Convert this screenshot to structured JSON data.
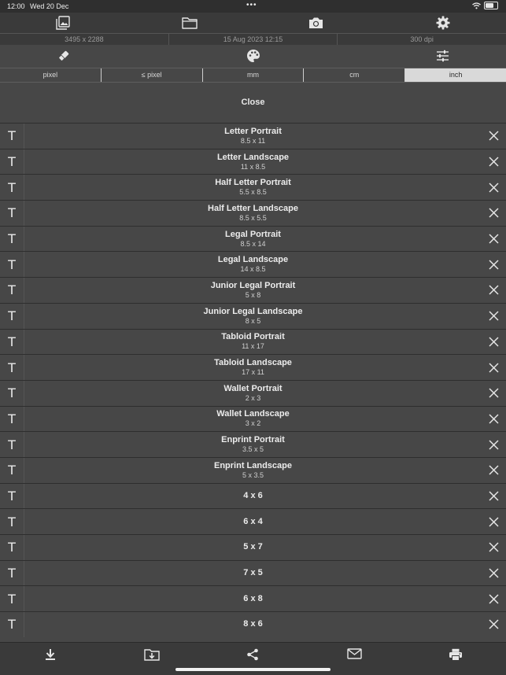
{
  "status_bar": {
    "time": "12:00",
    "date": "Wed 20 Dec",
    "dots": "•••"
  },
  "toolbar_top": {
    "icons": [
      "photo-library-icon",
      "folder-icon",
      "camera-icon",
      "gear-icon"
    ]
  },
  "info": {
    "dimensions": "3495 x 2288",
    "datetime": "15 Aug 2023 12:15",
    "dpi": "300 dpi"
  },
  "toolbar_second": {
    "icons": [
      "eraser-icon",
      "palette-icon",
      "sliders-icon"
    ]
  },
  "unit_tabs": {
    "items": [
      "pixel",
      "≤ pixel",
      "mm",
      "cm",
      "inch"
    ],
    "selected": "inch"
  },
  "close_label": "Close",
  "row_glyph": "T",
  "presets": [
    {
      "name": "Letter Portrait",
      "size": "8.5 x 11"
    },
    {
      "name": "Letter Landscape",
      "size": "11 x 8.5"
    },
    {
      "name": "Half Letter Portrait",
      "size": "5.5 x 8.5"
    },
    {
      "name": "Half Letter Landscape",
      "size": "8.5 x 5.5"
    },
    {
      "name": "Legal Portrait",
      "size": "8.5 x 14"
    },
    {
      "name": "Legal Landscape",
      "size": "14 x 8.5"
    },
    {
      "name": "Junior Legal Portrait",
      "size": "5 x 8"
    },
    {
      "name": "Junior Legal Landscape",
      "size": "8 x 5"
    },
    {
      "name": "Tabloid Portrait",
      "size": "11 x 17"
    },
    {
      "name": "Tabloid Landscape",
      "size": "17 x 11"
    },
    {
      "name": "Wallet Portrait",
      "size": "2 x 3"
    },
    {
      "name": "Wallet Landscape",
      "size": "3 x 2"
    },
    {
      "name": "Enprint Portrait",
      "size": "3.5 x 5"
    },
    {
      "name": "Enprint Landscape",
      "size": "5 x 3.5"
    },
    {
      "name": "4 x 6",
      "size": ""
    },
    {
      "name": "6 x 4",
      "size": ""
    },
    {
      "name": "5 x 7",
      "size": ""
    },
    {
      "name": "7 x 5",
      "size": ""
    },
    {
      "name": "6 x 8",
      "size": ""
    },
    {
      "name": "8 x 6",
      "size": ""
    }
  ],
  "toolbar_bottom": {
    "icons": [
      "download-icon",
      "save-to-folder-icon",
      "share-icon",
      "mail-icon",
      "print-icon"
    ]
  },
  "colors": {
    "background": "#474747",
    "toolbar": "#3a3a3a",
    "selected_tab": "#d9d9d9",
    "text": "#e6e6e6"
  }
}
